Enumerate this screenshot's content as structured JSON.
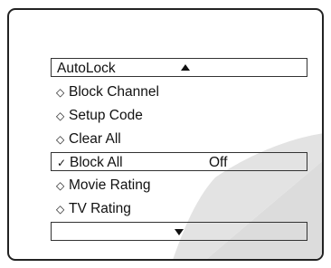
{
  "menu": {
    "header": {
      "label": "AutoLock"
    },
    "items": [
      {
        "marker": "◇",
        "label": "Block Channel",
        "value": ""
      },
      {
        "marker": "◇",
        "label": "Setup Code",
        "value": ""
      },
      {
        "marker": "◇",
        "label": "Clear All",
        "value": ""
      },
      {
        "marker": "✓",
        "label": "Block All",
        "value": "Off"
      },
      {
        "marker": "◇",
        "label": "Movie Rating",
        "value": ""
      },
      {
        "marker": "◇",
        "label": "TV Rating",
        "value": ""
      }
    ]
  },
  "icons": {
    "scroll_up": "up-arrow-icon",
    "scroll_down": "down-arrow-icon",
    "unselected": "diamond-icon",
    "selected": "checkmark-icon"
  },
  "colors": {
    "frame": "#222222",
    "arc_shade": "#dcdcdc",
    "text": "#111111"
  }
}
